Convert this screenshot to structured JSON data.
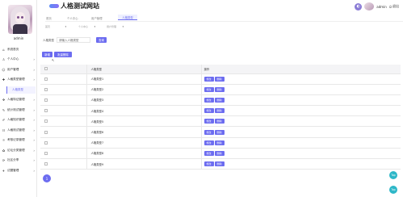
{
  "header": {
    "title": "人格测试网站",
    "user": "admin",
    "logout": "退出"
  },
  "sidebar": {
    "user_name": "admin",
    "items": [
      {
        "icon": "home-icon",
        "glyph": "⌂",
        "label": "系统首页",
        "arrow": false
      },
      {
        "icon": "person-icon",
        "glyph": "♙",
        "label": "个人中心",
        "arrow": true
      },
      {
        "icon": "users-icon",
        "glyph": "☺",
        "label": "用户管理",
        "arrow": true
      },
      {
        "icon": "type-icon",
        "glyph": "✚",
        "label": "人格类型管理",
        "arrow": true,
        "submenu": "人格类型"
      },
      {
        "icon": "feature-icon",
        "glyph": "❖",
        "label": "人格特征管理",
        "arrow": true
      },
      {
        "icon": "test-icon",
        "glyph": "✎",
        "label": "统计测试管理",
        "arrow": true
      },
      {
        "icon": "knowledge-icon",
        "glyph": "✐",
        "label": "人格知识管理",
        "arrow": true
      },
      {
        "icon": "quiz-icon",
        "glyph": "☷",
        "label": "人格测试管理",
        "arrow": true
      },
      {
        "icon": "record-icon",
        "glyph": "☼",
        "label": "考核记录管理",
        "arrow": true
      },
      {
        "icon": "forum-icon",
        "glyph": "✿",
        "label": "论坛分类管理",
        "arrow": true
      },
      {
        "icon": "share-icon",
        "glyph": "⟳",
        "label": "社区分享",
        "arrow": true
      },
      {
        "icon": "exam-icon",
        "glyph": "✈",
        "label": "试题管理",
        "arrow": true
      }
    ]
  },
  "nav": {
    "tabs": [
      {
        "label": "首页",
        "sub": "♦"
      },
      {
        "label": "个人中心",
        "sub": "♦"
      },
      {
        "label": "用户管理",
        "sub": "♦"
      },
      {
        "label": "人格类型",
        "sub": ""
      }
    ]
  },
  "search": {
    "label": "人格类型",
    "placeholder": "请输入人格类型",
    "button": "查询"
  },
  "actions": {
    "add": "新增",
    "batch_delete": "批量删除"
  },
  "table": {
    "headers": [
      "",
      "人格类型",
      "操作"
    ],
    "rows": [
      {
        "type": "人格类型1"
      },
      {
        "type": "人格类型2"
      },
      {
        "type": "人格类型3"
      },
      {
        "type": "人格类型4"
      },
      {
        "type": "人格类型5"
      },
      {
        "type": "人格类型6"
      },
      {
        "type": "人格类型7"
      },
      {
        "type": "人格类型8"
      },
      {
        "type": "人格类型9"
      }
    ],
    "op_edit": "修改",
    "op_delete": "删除"
  },
  "pagination": {
    "current": "1"
  },
  "float_buttons": [
    "Top",
    "Top"
  ],
  "colors": {
    "accent": "#6c6cf0",
    "float": "#2db7c8"
  }
}
